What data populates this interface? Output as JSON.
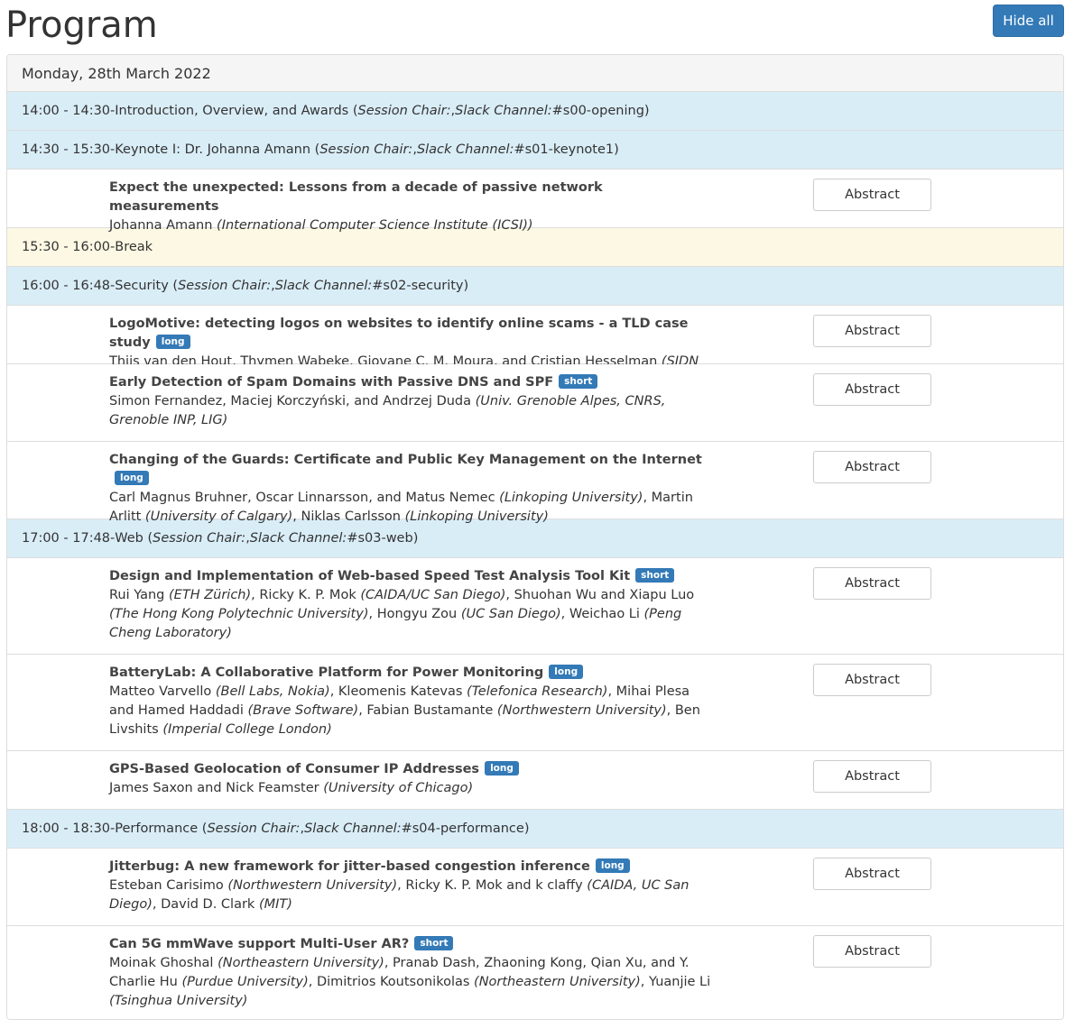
{
  "page_title": "Program",
  "hide_all_label": "Hide all",
  "day": "Monday, 28th March 2022",
  "abstract_label": "Abstract",
  "rows": [
    {
      "type": "session",
      "time": "14:00 - 14:30",
      "title": "Introduction, Overview, and Awards",
      "chair_label": "Session Chair:",
      "chair": "",
      "slack_label": "Slack Channel:",
      "slack": "#s00-opening"
    },
    {
      "type": "session",
      "time": "14:30 - 15:30",
      "title": "Keynote I: Dr. Johanna Amann",
      "chair_label": "Session Chair:",
      "chair": "",
      "slack_label": "Slack Channel:",
      "slack": "#s01-keynote1"
    },
    {
      "type": "talk",
      "height": 65,
      "title": "Expect the unexpected: Lessons from a decade of passive network measurements",
      "badge": "",
      "authors": [
        {
          "names": "Johanna Amann",
          "aff": "International Computer Science Institute (ICSI)"
        }
      ]
    },
    {
      "type": "break",
      "time": "15:30 - 16:00",
      "title": "Break"
    },
    {
      "type": "session",
      "time": "16:00 - 16:48",
      "title": "Security",
      "chair_label": "Session Chair:",
      "chair": "",
      "slack_label": "Slack Channel:",
      "slack": "#s02-security"
    },
    {
      "type": "talk",
      "height": 65,
      "title": "LogoMotive: detecting logos on websites to identify online scams - a TLD case study",
      "badge": "long",
      "authors": [
        {
          "names": "Thijs van den Hout, Thymen Wabeke, Giovane C. M. Moura, and Cristian Hesselman",
          "aff": "SIDN Labs"
        }
      ]
    },
    {
      "type": "talk",
      "height": 86,
      "title": "Early Detection of Spam Domains with Passive DNS and SPF",
      "badge": "short",
      "authors": [
        {
          "names": "Simon Fernandez, Maciej Korczyński, and Andrzej Duda",
          "aff": "Univ. Grenoble Alpes, CNRS, Grenoble INP, LIG"
        }
      ]
    },
    {
      "type": "talk",
      "height": 86,
      "title": "Changing of the Guards: Certificate and Public Key Management on the Internet",
      "badge": "long",
      "authors": [
        {
          "names": "Carl Magnus Bruhner, Oscar Linnarsson, and Matus Nemec",
          "aff": "Linkoping University"
        },
        {
          "names": "Martin Arlitt",
          "aff": "University of Calgary"
        },
        {
          "names": "Niklas Carlsson",
          "aff": "Linkoping University"
        }
      ]
    },
    {
      "type": "session",
      "time": "17:00 - 17:48",
      "title": "Web",
      "chair_label": "Session Chair:",
      "chair": "",
      "slack_label": "Slack Channel:",
      "slack": "#s03-web"
    },
    {
      "type": "talk",
      "height": 107,
      "title": "Design and Implementation of Web-based Speed Test Analysis Tool Kit",
      "badge": "short",
      "authors": [
        {
          "names": "Rui Yang",
          "aff": "ETH Zürich"
        },
        {
          "names": "Ricky K. P. Mok",
          "aff": "CAIDA/UC San Diego"
        },
        {
          "names": "Shuohan Wu and Xiapu Luo",
          "aff": "The Hong Kong Polytechnic University"
        },
        {
          "names": "Hongyu Zou",
          "aff": "UC San Diego"
        },
        {
          "names": "Weichao Li",
          "aff": "Peng Cheng Laboratory"
        }
      ]
    },
    {
      "type": "talk",
      "height": 107,
      "title": "BatteryLab: A Collaborative Platform for Power Monitoring",
      "badge": "long",
      "authors": [
        {
          "names": "Matteo Varvello",
          "aff": "Bell Labs, Nokia"
        },
        {
          "names": "Kleomenis Katevas",
          "aff": "Telefonica Research"
        },
        {
          "names": "Mihai Plesa and Hamed Haddadi",
          "aff": "Brave Software"
        },
        {
          "names": "Fabian Bustamante",
          "aff": "Northwestern University"
        },
        {
          "names": "Ben Livshits",
          "aff": "Imperial College London"
        }
      ]
    },
    {
      "type": "talk",
      "height": 65,
      "title": "GPS-Based Geolocation of Consumer IP Addresses",
      "badge": "long",
      "authors": [
        {
          "names": "James Saxon and Nick Feamster",
          "aff": "University of Chicago"
        }
      ]
    },
    {
      "type": "session",
      "time": "18:00 - 18:30",
      "title": "Performance",
      "chair_label": "Session Chair:",
      "chair": "",
      "slack_label": "Slack Channel:",
      "slack": "#s04-performance"
    },
    {
      "type": "talk",
      "height": 86,
      "title": "Jitterbug: A new framework for jitter-based congestion inference",
      "badge": "long",
      "authors": [
        {
          "names": "Esteban Carisimo",
          "aff": "Northwestern University"
        },
        {
          "names": "Ricky K. P. Mok and k claffy",
          "aff": "CAIDA, UC San Diego"
        },
        {
          "names": "David D. Clark",
          "aff": "MIT"
        }
      ]
    },
    {
      "type": "talk",
      "height": 107,
      "title": "Can 5G mmWave support Multi-User AR?",
      "badge": "short",
      "authors": [
        {
          "names": "Moinak Ghoshal",
          "aff": "Northeastern University"
        },
        {
          "names": "Pranab Dash, Zhaoning Kong, Qian Xu, and Y. Charlie Hu",
          "aff": "Purdue University"
        },
        {
          "names": "Dimitrios Koutsonikolas",
          "aff": "Northeastern University"
        },
        {
          "names": "Yuanjie Li",
          "aff": "Tsinghua University"
        }
      ]
    }
  ]
}
